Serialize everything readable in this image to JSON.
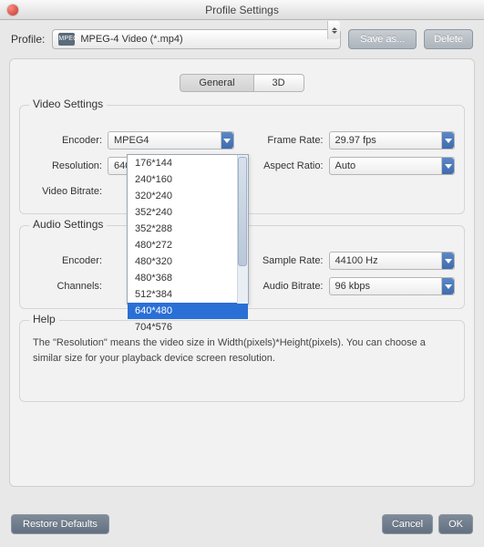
{
  "window": {
    "title": "Profile Settings"
  },
  "top": {
    "profile_label": "Profile:",
    "profile_value": "MPEG-4 Video (*.mp4)",
    "badge_text": "MPEG",
    "save_as": "Save as...",
    "delete": "Delete"
  },
  "tabs": {
    "general": "General",
    "threeD": "3D"
  },
  "video": {
    "legend": "Video Settings",
    "labels": {
      "encoder": "Encoder:",
      "resolution": "Resolution:",
      "bitrate": "Video Bitrate:",
      "framerate": "Frame Rate:",
      "aspect": "Aspect Ratio:"
    },
    "values": {
      "encoder": "MPEG4",
      "resolution": "640*480",
      "bitrate": "",
      "framerate": "29.97 fps",
      "aspect": "Auto"
    }
  },
  "audio": {
    "legend": "Audio Settings",
    "labels": {
      "encoder": "Encoder:",
      "channels": "Channels:",
      "samplerate": "Sample Rate:",
      "bitrate": "Audio Bitrate:"
    },
    "values": {
      "encoder": "",
      "channels": "",
      "samplerate": "44100 Hz",
      "bitrate": "96 kbps"
    }
  },
  "resolution_options": [
    "176*144",
    "240*160",
    "320*240",
    "352*240",
    "352*288",
    "480*272",
    "480*320",
    "480*368",
    "512*384",
    "640*480",
    "704*576"
  ],
  "resolution_selected": "640*480",
  "help": {
    "legend": "Help",
    "text": "The \"Resolution\" means the video size in Width(pixels)*Height(pixels).  You can choose a similar size for your playback device screen resolution."
  },
  "footer": {
    "restore": "Restore Defaults",
    "cancel": "Cancel",
    "ok": "OK"
  }
}
